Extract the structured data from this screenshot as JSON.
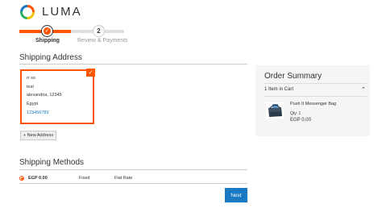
{
  "brand": {
    "name": "LUMA"
  },
  "progress": {
    "steps": [
      {
        "number": "",
        "label": "Shipping"
      },
      {
        "number": "2",
        "label": "Review & Payments"
      }
    ]
  },
  "shipping_address": {
    "heading": "Shipping Address",
    "address_lines": [
      "rr ss",
      "test",
      "alexandria, 12345",
      "Egypt"
    ],
    "phone": "123456789",
    "new_address_label": "+ New Address"
  },
  "shipping_methods": {
    "heading": "Shipping Methods",
    "rows": [
      {
        "price": "EGP 0.00",
        "method": "Fixed",
        "carrier": "Flat Rate"
      }
    ]
  },
  "next_label": "Next",
  "order_summary": {
    "title": "Order Summary",
    "items_in_cart": "1 Item in Cart",
    "product": {
      "name": "Push It Messenger Bag",
      "qty": "Qty: 1",
      "price": "EGP 0.00"
    }
  },
  "colors": {
    "accent": "#ff5501",
    "link": "#1979c3",
    "summary_bg": "#f5f5f5"
  }
}
